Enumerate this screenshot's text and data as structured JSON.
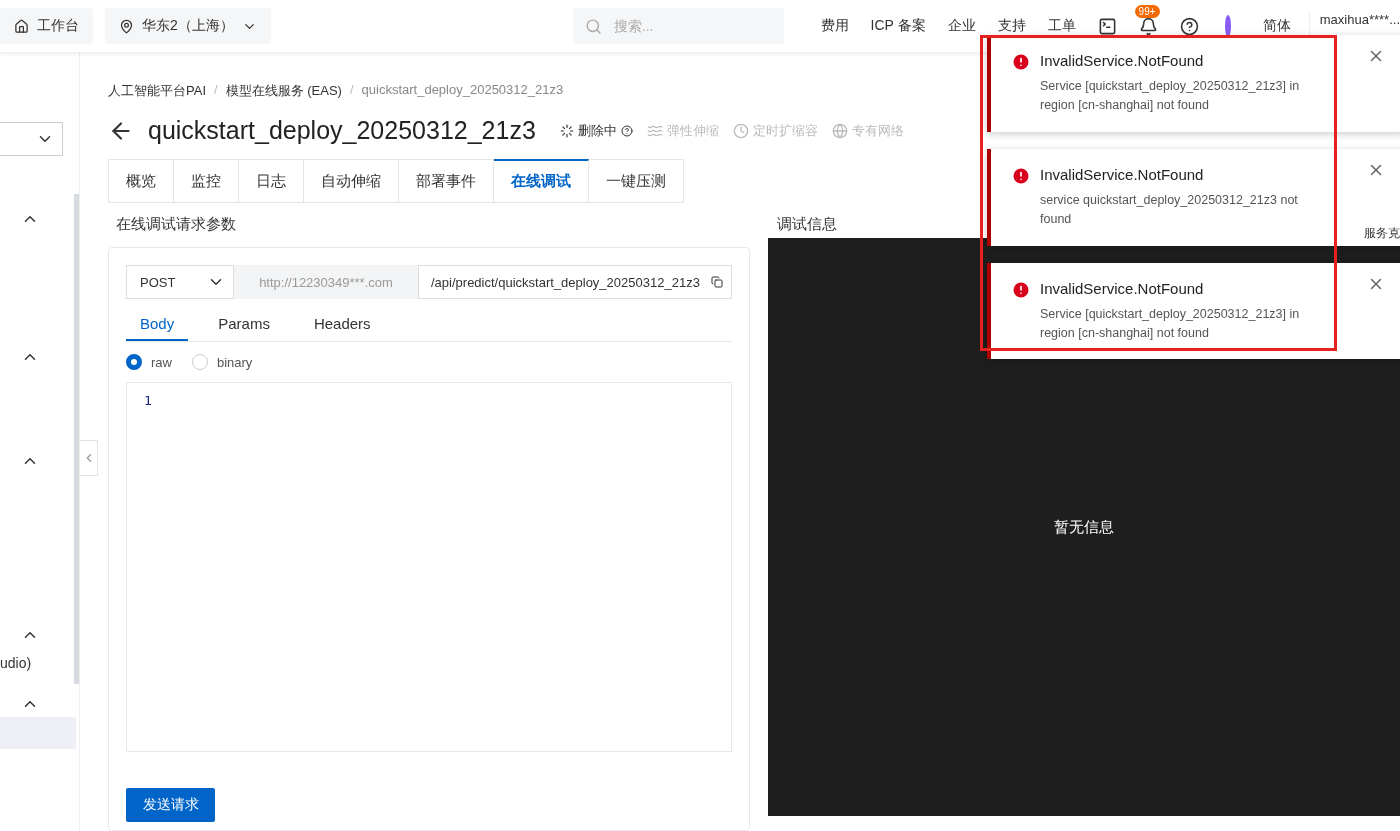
{
  "topbar": {
    "home": "工作台",
    "region": "华东2（上海）",
    "search_placeholder": "搜索...",
    "links": [
      "费用",
      "ICP 备案",
      "企业",
      "支持",
      "工单"
    ],
    "badge": "99+",
    "language": "简体",
    "user": "maxihua****..."
  },
  "sidebar": {
    "items": [
      {
        "kind": "select"
      },
      {
        "kind": "group",
        "expanded": true
      },
      {
        "kind": "group",
        "expanded": true
      },
      {
        "kind": "group",
        "expanded": true
      },
      {
        "kind": "group",
        "expanded": true
      },
      {
        "kind": "text",
        "label": "udio)"
      },
      {
        "kind": "group",
        "expanded": true
      },
      {
        "kind": "item",
        "selected": true
      }
    ]
  },
  "breadcrumb_separators": [
    "/",
    "/"
  ],
  "breadcrumb": [
    "人工智能平台PAI",
    "模型在线服务 (EAS)",
    "quickstart_deploy_20250312_21z3"
  ],
  "title": "quickstart_deploy_20250312_21z3",
  "status": "删除中",
  "features": [
    {
      "kind": "scale",
      "label": "弹性伸缩",
      "disabled": true
    },
    {
      "kind": "clock",
      "label": "定时扩缩容",
      "disabled": true
    },
    {
      "kind": "globe",
      "label": "专有网络",
      "disabled": true
    }
  ],
  "tabs": [
    {
      "label": "概览",
      "selected": false
    },
    {
      "label": "监控",
      "selected": false
    },
    {
      "label": "日志",
      "selected": false
    },
    {
      "label": "自动伸缩",
      "selected": false
    },
    {
      "label": "部署事件",
      "selected": false
    },
    {
      "label": "在线调试",
      "selected": true
    },
    {
      "label": "一键压测",
      "selected": false
    }
  ],
  "request": {
    "heading": "在线调试请求参数",
    "method": "POST",
    "host": "http://12230349***.com",
    "path": "/api/predict/quickstart_deploy_20250312_21z3",
    "subtabs": [
      {
        "label": "Body",
        "selected": true
      },
      {
        "label": "Params",
        "selected": false
      },
      {
        "label": "Headers",
        "selected": false
      }
    ],
    "body_types": [
      {
        "label": "raw",
        "selected": true
      },
      {
        "label": "binary",
        "selected": false
      }
    ],
    "line_numbers": [
      "1"
    ],
    "send": "发送请求"
  },
  "response": {
    "heading": "调试信息",
    "empty": "暂无信息",
    "side_text": "服务克"
  },
  "notifications": [
    {
      "title": "InvalidService.NotFound",
      "message": "Service [quickstart_deploy_20250312_21z3] in region [cn-shanghai] not found"
    },
    {
      "title": "InvalidService.NotFound",
      "message": "service quickstart_deploy_20250312_21z3 not found"
    },
    {
      "title": "InvalidService.NotFound",
      "message": "Service [quickstart_deploy_20250312_21z3] in region [cn-shanghai] not found"
    }
  ]
}
